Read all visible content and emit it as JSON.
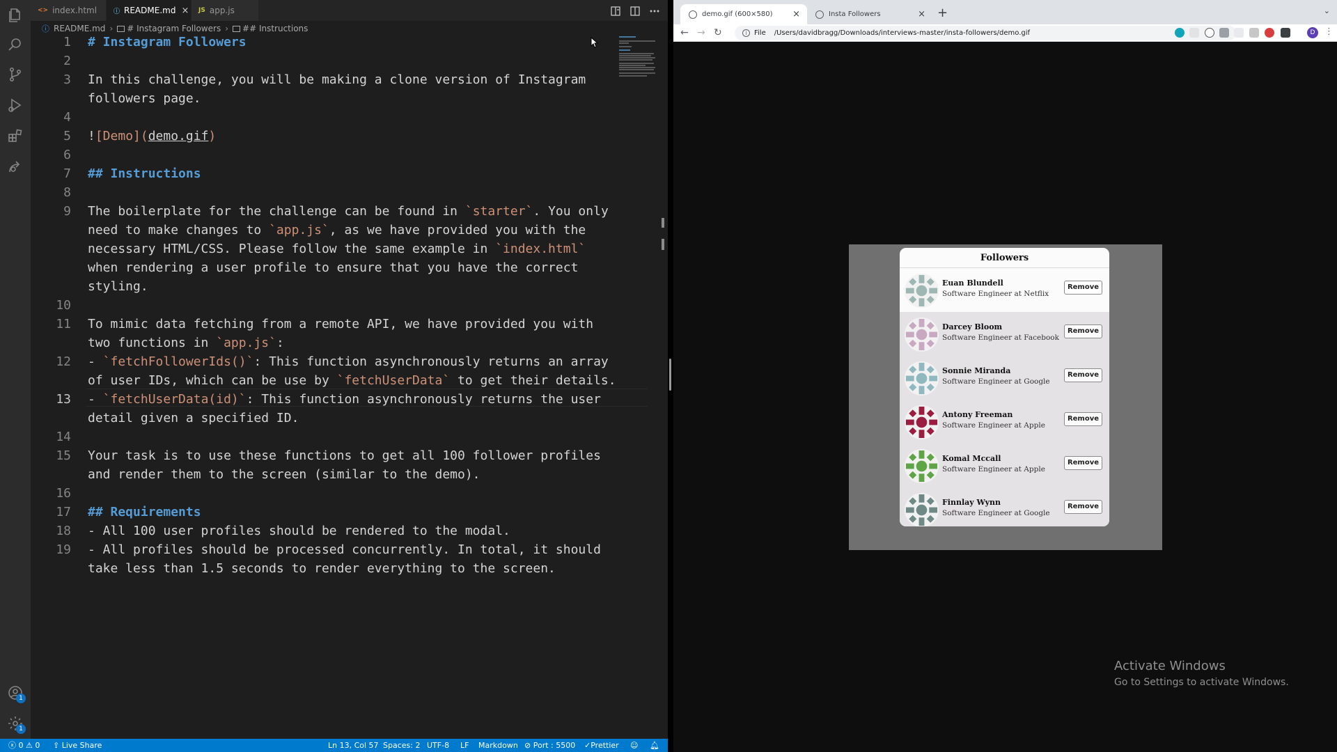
{
  "vscode": {
    "tabs": [
      {
        "label": "index.html",
        "icon": "<>",
        "icon_color": "#e37933"
      },
      {
        "label": "README.md",
        "icon": "ⓘ",
        "icon_color": "#519aba"
      },
      {
        "label": "app.js",
        "icon": "JS",
        "icon_color": "#cbcb41"
      }
    ],
    "breadcrumb": {
      "file": "README.md",
      "section1": "# Instagram Followers",
      "section2": "## Instructions"
    },
    "line_numbers": [
      "1",
      "2",
      "3",
      "4",
      "5",
      "6",
      "7",
      "8",
      "9",
      "10",
      "11",
      "12",
      "13",
      "14",
      "15",
      "16",
      "17",
      "18",
      "19"
    ],
    "current_line": "13",
    "code": {
      "l1": "# Instagram Followers",
      "l3a": "In this challenge, you will be making a clone version of Instagram",
      "l3b": "followers page.",
      "l5_bang": "!",
      "l5_alt": "[Demo]",
      "l5_open": "(",
      "l5_url": "demo.gif",
      "l5_close": ")",
      "l7": "## Instructions",
      "l9a_pre": "The boilerplate for the challenge can be found in ",
      "l9a_code": "`starter`",
      "l9a_post": ". You only",
      "l9b_pre": "need to make changes to ",
      "l9b_code": "`app.js`",
      "l9b_post": ", as we have provided you with the",
      "l9c_pre": "necessary HTML/CSS. Please follow the same example in ",
      "l9c_code": "`index.html`",
      "l9d": "when rendering a user profile to ensure that you have the correct",
      "l9e": "styling.",
      "l11a": "To mimic data fetching from a remote API, we have provided you with",
      "l11b_pre": "two functions in ",
      "l11b_code": "`app.js`",
      "l11b_post": ":",
      "l12a_pre": "- ",
      "l12a_code": "`fetchFollowerIds()`",
      "l12a_post": ": This function asynchronously returns an array",
      "l12b_pre": "of user IDs, which can be use by ",
      "l12b_code": "`fetchUserData`",
      "l12b_post": " to get their details.",
      "l13a_pre": "- ",
      "l13a_code": "`fetchUserData(id)`",
      "l13a_post": ": This function asynchronously returns the user",
      "l13b": "detail given a specified ID.",
      "l15a": "Your task is to use these functions to get all 100 follower profiles",
      "l15b": "and render them to the screen (similar to the demo).",
      "l17": "## Requirements",
      "l18": "- All 100 user profiles should be rendered to the modal.",
      "l19a": "- All profiles should be processed concurrently. In total, it should",
      "l19b": "take less than 1.5 seconds to render everything to the screen."
    },
    "status": {
      "errors": "0",
      "warnings": "0",
      "live_share": "Live Share",
      "position": "Ln 13, Col 57",
      "spaces": "Spaces: 2",
      "encoding": "UTF-8",
      "eol": "LF",
      "language": "Markdown",
      "port": "Port : 5500",
      "prettier": "Prettier"
    },
    "account_badge": "1",
    "settings_badge": "1",
    "colors": {
      "statusbar": "#007acc",
      "heading": "#569cd6",
      "code": "#ce9178"
    }
  },
  "browser": {
    "tabs": [
      {
        "label": "demo.gif (600×580)"
      },
      {
        "label": "Insta Followers"
      }
    ],
    "address": {
      "scheme_label": "File",
      "url": "/Users/davidbragg/Downloads/interviews-master/insta-followers/demo.gif"
    },
    "profile_initial": "D",
    "modal": {
      "title": "Followers",
      "followers": [
        {
          "name": "Euan Blundell",
          "job": "Software Engineer at Netflix",
          "color": "#9fb7b3",
          "button": "Remove"
        },
        {
          "name": "Darcey Bloom",
          "job": "Software Engineer at Facebook",
          "color": "#c9a8c2",
          "button": "Remove"
        },
        {
          "name": "Sonnie Miranda",
          "job": "Software Engineer at Google",
          "color": "#8fb8bf",
          "button": "Remove"
        },
        {
          "name": "Antony Freeman",
          "job": "Software Engineer at Apple",
          "color": "#9b1d3f",
          "button": "Remove"
        },
        {
          "name": "Komal Mccall",
          "job": "Software Engineer at Apple",
          "color": "#5fa547",
          "button": "Remove"
        },
        {
          "name": "Finnlay Wynn",
          "job": "Software Engineer at Google",
          "color": "#6f8a86",
          "button": "Remove"
        }
      ]
    }
  },
  "watermark": {
    "title": "Activate Windows",
    "subtitle": "Go to Settings to activate Windows."
  }
}
